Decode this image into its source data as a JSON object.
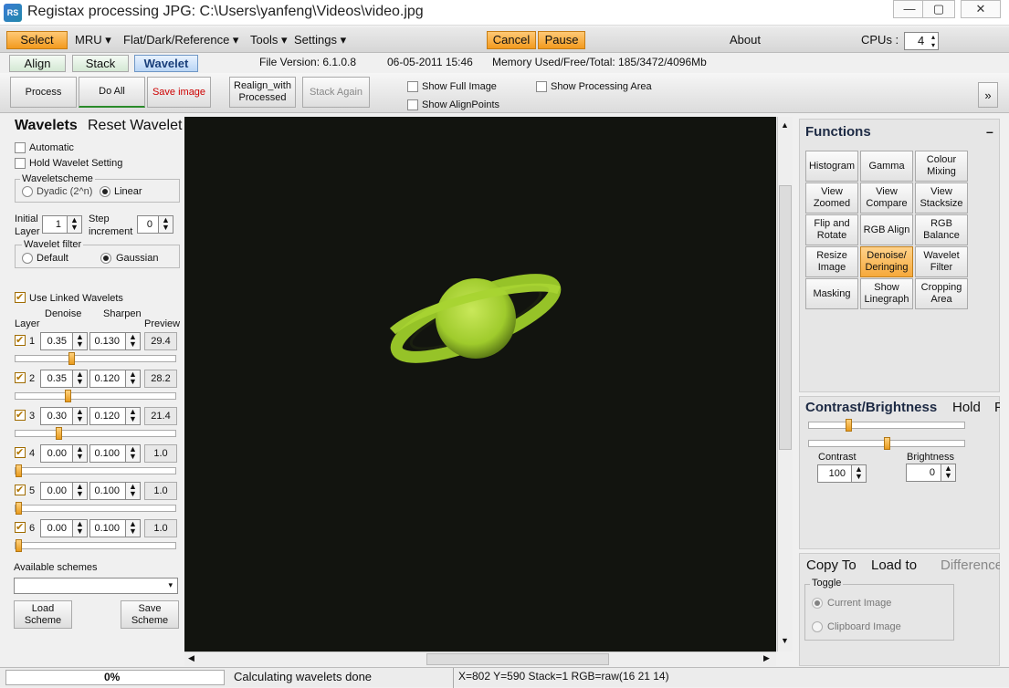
{
  "window": {
    "logo": "RS",
    "title": "Registax processing JPG: C:\\Users\\yanfeng\\Videos\\video.jpg",
    "minimize": "—",
    "maximize": "▢",
    "close": "✕"
  },
  "menu": {
    "select": "Select",
    "mru": "MRU ▾",
    "flat": "Flat/Dark/Reference ▾",
    "tools": "Tools ▾",
    "settings": "Settings ▾",
    "cancel": "Cancel",
    "pause": "Pause",
    "about": "About",
    "cpus_label": "CPUs :",
    "cpus_value": "4"
  },
  "tabs": {
    "align": "Align",
    "stack": "Stack",
    "wavelet": "Wavelet"
  },
  "info": {
    "version": "File Version: 6.1.0.8",
    "date": "06-05-2011 15:46",
    "memory": "Memory Used/Free/Total: 185/3472/4096Mb"
  },
  "toolbar": {
    "process": "Process",
    "do_all": "Do All",
    "save_image": "Save image",
    "realign": "Realign_with Processed",
    "stack_again": "Stack Again",
    "show_full_image": "Show Full Image",
    "show_processing_area": "Show Processing Area",
    "show_alignpoints": "Show AlignPoints",
    "more": "»"
  },
  "wavelets": {
    "title": "Wavelets",
    "reset": "Reset Wavelet",
    "automatic": "Automatic",
    "hold": "Hold Wavelet Setting",
    "scheme_group": "Waveletscheme",
    "dyadic": "Dyadic (2^n)",
    "linear": "Linear",
    "initial_layer_label": "Initial Layer",
    "initial_layer": "1",
    "step_label": "Step increment",
    "step": "0",
    "filter_group": "Wavelet filter",
    "default": "Default",
    "gaussian": "Gaussian",
    "use_linked": "Use Linked Wavelets",
    "col_layer": "Layer",
    "col_denoise": "Denoise",
    "col_sharpen": "Sharpen",
    "col_preview": "Preview",
    "layers": [
      {
        "num": "1",
        "denoise": "0.35",
        "sharpen": "0.130",
        "preview": "29.4",
        "slider": 0.34
      },
      {
        "num": "2",
        "denoise": "0.35",
        "sharpen": "0.120",
        "preview": "28.2",
        "slider": 0.32
      },
      {
        "num": "3",
        "denoise": "0.30",
        "sharpen": "0.120",
        "preview": "21.4",
        "slider": 0.26
      },
      {
        "num": "4",
        "denoise": "0.00",
        "sharpen": "0.100",
        "preview": "1.0",
        "slider": 0.0
      },
      {
        "num": "5",
        "denoise": "0.00",
        "sharpen": "0.100",
        "preview": "1.0",
        "slider": 0.0
      },
      {
        "num": "6",
        "denoise": "0.00",
        "sharpen": "0.100",
        "preview": "1.0",
        "slider": 0.0
      }
    ],
    "available_schemes": "Available schemes",
    "load_scheme": "Load Scheme",
    "save_scheme": "Save Scheme"
  },
  "functions": {
    "title": "Functions",
    "collapse": "–",
    "buttons": [
      "Histogram",
      "Gamma",
      "Colour Mixing",
      "View Zoomed",
      "View Compare",
      "View Stacksize",
      "Flip and Rotate",
      "RGB Align",
      "RGB Balance",
      "Resize Image",
      "Denoise/ Deringing",
      "Wavelet Filter",
      "Masking",
      "Show Linegraph",
      "Cropping Area"
    ]
  },
  "contrast": {
    "title": "Contrast/Brightness",
    "hold": "Hold",
    "extra": "F",
    "contrast_label": "Contrast",
    "contrast_value": "100",
    "brightness_label": "Brightness",
    "brightness_value": "0"
  },
  "copy": {
    "copy_to": "Copy To",
    "load_to": "Load to",
    "difference": "Difference",
    "toggle": "Toggle",
    "current": "Current Image",
    "clipboard": "Clipboard Image"
  },
  "status": {
    "progress": "0%",
    "message": "Calculating wavelets done",
    "coords": "X=802 Y=590 Stack=1 RGB=raw(16 21 14)"
  },
  "colors": {
    "accent": "#f39a1e",
    "planet": "#b8dc3a"
  }
}
